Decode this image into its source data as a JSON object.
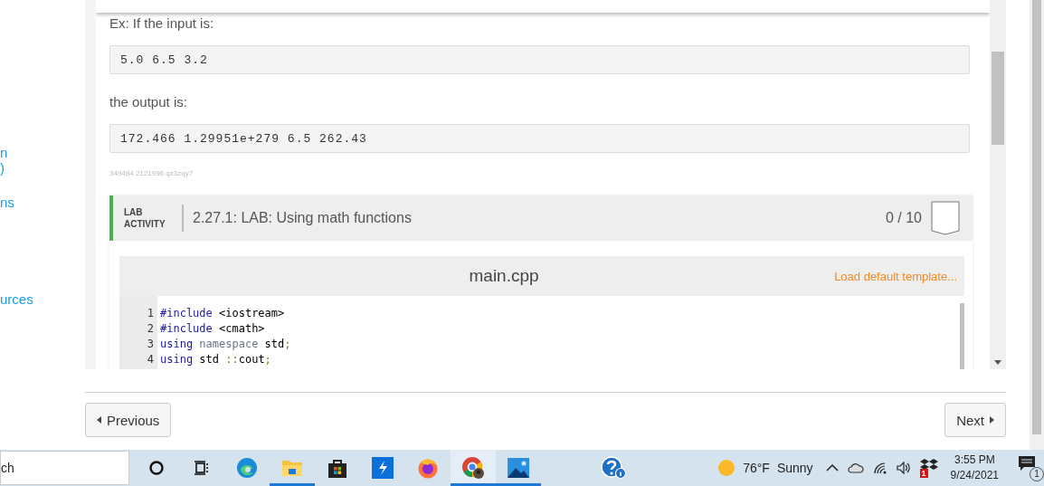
{
  "sidebar": {
    "links": [
      "n",
      ")",
      "ns",
      "urces"
    ]
  },
  "content": {
    "intro": "Ex: If the input is:",
    "input_sample": "5.0 6.5 3.2",
    "output_label": "the output is:",
    "output_sample": "172.466 1.29951e+279 6.5 262.43",
    "code_id": "349484.2121996.qx3zqy7"
  },
  "lab": {
    "tag": "LAB ACTIVITY",
    "title": "2.27.1: LAB: Using math functions",
    "score": "0 / 10",
    "completed": false,
    "editor": {
      "filename": "main.cpp",
      "template_link": "Load default template...",
      "lines": [
        {
          "number": "1",
          "tokens": [
            {
              "text": "#include",
              "kind": "keyword"
            },
            {
              "text": " <iostream>",
              "kind": "plain"
            }
          ]
        },
        {
          "number": "2",
          "tokens": [
            {
              "text": "#include",
              "kind": "keyword"
            },
            {
              "text": " <cmath>",
              "kind": "plain"
            }
          ]
        },
        {
          "number": "3",
          "tokens": [
            {
              "text": "using",
              "kind": "keyword"
            },
            {
              "text": " namespace",
              "kind": "def"
            },
            {
              "text": " std",
              "kind": "plain"
            },
            {
              "text": ";",
              "kind": "punct"
            }
          ]
        },
        {
          "number": "4",
          "tokens": [
            {
              "text": "using",
              "kind": "keyword"
            },
            {
              "text": " std ",
              "kind": "plain"
            },
            {
              "text": "::",
              "kind": "punct"
            },
            {
              "text": "cout",
              "kind": "plain"
            },
            {
              "text": ";",
              "kind": "punct"
            }
          ]
        }
      ]
    }
  },
  "nav": {
    "previous": "Previous",
    "next": "Next"
  },
  "taskbar": {
    "search_text": "ch",
    "apps": [
      {
        "kind": "cortana",
        "running": false,
        "active": false
      },
      {
        "kind": "taskview",
        "running": false,
        "active": false
      },
      {
        "kind": "edge",
        "running": false,
        "active": false
      },
      {
        "kind": "explorer",
        "running": true,
        "active": false
      },
      {
        "kind": "store",
        "running": false,
        "active": false
      },
      {
        "kind": "bolt",
        "running": false,
        "active": false
      },
      {
        "kind": "firefox",
        "running": false,
        "active": false
      },
      {
        "kind": "chrome",
        "running": true,
        "active": true
      },
      {
        "kind": "photos",
        "running": true,
        "active": false
      },
      {
        "kind": "help",
        "running": false,
        "active": false
      }
    ],
    "weather": {
      "temperature": "76°F",
      "condition": "Sunny"
    },
    "dropbox_badge": "1",
    "time": "3:55 PM",
    "date": "9/24/2021",
    "notification_count": "1"
  }
}
